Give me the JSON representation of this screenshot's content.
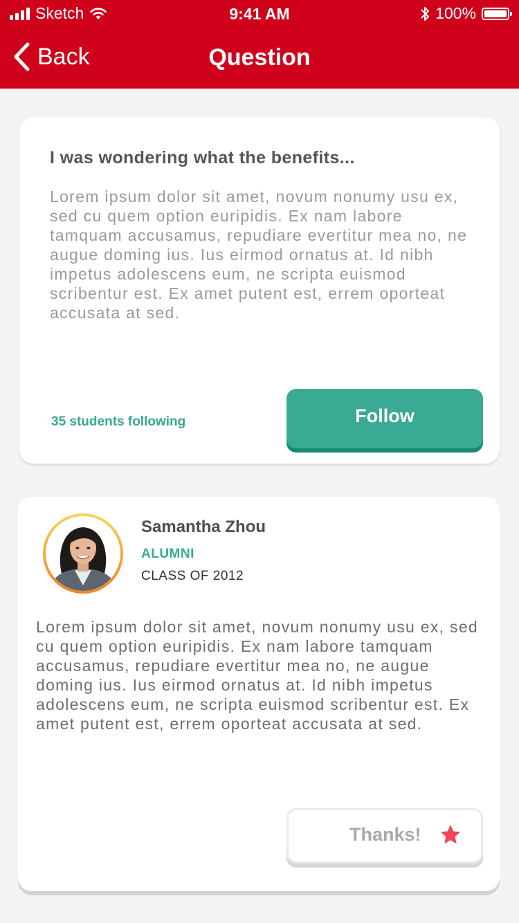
{
  "status_bar": {
    "carrier": "Sketch",
    "time": "9:41 AM",
    "battery": "100%"
  },
  "nav": {
    "back_label": "Back",
    "title": "Question"
  },
  "question": {
    "title": "I was wondering what the benefits...",
    "body": "Lorem ipsum dolor sit amet, novum nonumy usu ex, sed cu quem option euripidis. Ex nam labore tamquam accusamus, repudiare evertitur mea no, ne augue doming ius. Ius eirmod ornatus at. Id nibh impetus adolescens eum, ne scripta euismod scribentur est. Ex amet putent est, errem oporteat accusata at sed.",
    "followers": "35 students following",
    "follow_label": "Follow"
  },
  "answer": {
    "name": "Samantha Zhou",
    "role": "ALUMNI",
    "class": "CLASS OF 2012",
    "body": "Lorem ipsum dolor sit amet, novum nonumy usu ex, sed cu quem option euripidis. Ex nam labore tamquam accusamus, repudiare evertitur mea no, ne augue doming ius. Ius eirmod ornatus at. Id nibh impetus adolescens eum, ne scripta euismod scribentur est. Ex amet putent est, errem oporteat accusata at sed.",
    "thanks_label": "Thanks!"
  },
  "colors": {
    "header": "#d0021b",
    "accent": "#3aaa94",
    "star": "#f0455a"
  },
  "icons": [
    "signal-icon",
    "wifi-icon",
    "bluetooth-icon",
    "battery-icon",
    "chevron-left-icon",
    "star-icon"
  ]
}
